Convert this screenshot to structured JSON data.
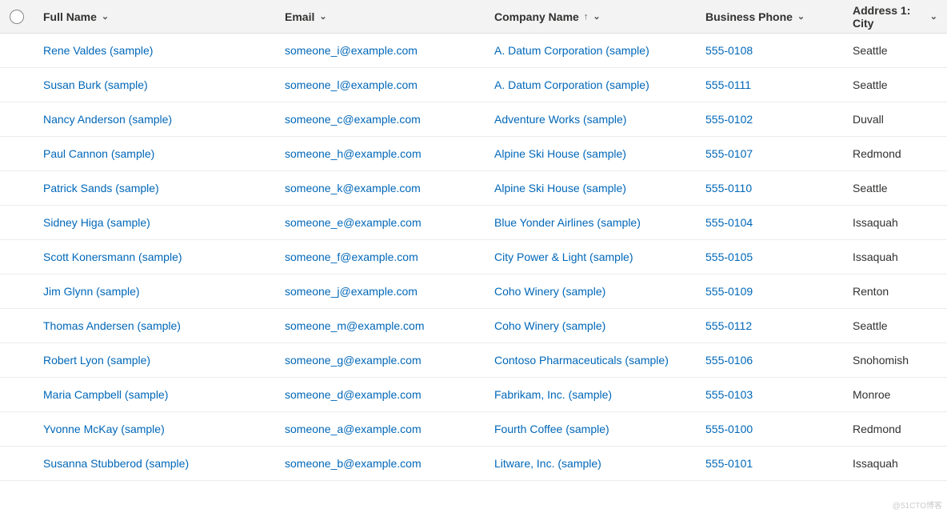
{
  "columns": {
    "fullname": "Full Name",
    "email": "Email",
    "company": "Company Name",
    "phone": "Business Phone",
    "city": "Address 1: City"
  },
  "sort": {
    "column": "company",
    "direction": "asc"
  },
  "rows": [
    {
      "fullname": "Rene Valdes (sample)",
      "email": "someone_i@example.com",
      "company": "A. Datum Corporation (sample)",
      "phone": "555-0108",
      "city": "Seattle"
    },
    {
      "fullname": "Susan Burk (sample)",
      "email": "someone_l@example.com",
      "company": "A. Datum Corporation (sample)",
      "phone": "555-0111",
      "city": "Seattle"
    },
    {
      "fullname": "Nancy Anderson (sample)",
      "email": "someone_c@example.com",
      "company": "Adventure Works (sample)",
      "phone": "555-0102",
      "city": "Duvall"
    },
    {
      "fullname": "Paul Cannon (sample)",
      "email": "someone_h@example.com",
      "company": "Alpine Ski House (sample)",
      "phone": "555-0107",
      "city": "Redmond"
    },
    {
      "fullname": "Patrick Sands (sample)",
      "email": "someone_k@example.com",
      "company": "Alpine Ski House (sample)",
      "phone": "555-0110",
      "city": "Seattle"
    },
    {
      "fullname": "Sidney Higa (sample)",
      "email": "someone_e@example.com",
      "company": "Blue Yonder Airlines (sample)",
      "phone": "555-0104",
      "city": "Issaquah"
    },
    {
      "fullname": "Scott Konersmann (sample)",
      "email": "someone_f@example.com",
      "company": "City Power & Light (sample)",
      "phone": "555-0105",
      "city": "Issaquah"
    },
    {
      "fullname": "Jim Glynn (sample)",
      "email": "someone_j@example.com",
      "company": "Coho Winery (sample)",
      "phone": "555-0109",
      "city": "Renton"
    },
    {
      "fullname": "Thomas Andersen (sample)",
      "email": "someone_m@example.com",
      "company": "Coho Winery (sample)",
      "phone": "555-0112",
      "city": "Seattle"
    },
    {
      "fullname": "Robert Lyon (sample)",
      "email": "someone_g@example.com",
      "company": "Contoso Pharmaceuticals (sample)",
      "phone": "555-0106",
      "city": "Snohomish"
    },
    {
      "fullname": "Maria Campbell (sample)",
      "email": "someone_d@example.com",
      "company": "Fabrikam, Inc. (sample)",
      "phone": "555-0103",
      "city": "Monroe"
    },
    {
      "fullname": "Yvonne McKay (sample)",
      "email": "someone_a@example.com",
      "company": "Fourth Coffee (sample)",
      "phone": "555-0100",
      "city": "Redmond"
    },
    {
      "fullname": "Susanna Stubberod (sample)",
      "email": "someone_b@example.com",
      "company": "Litware, Inc. (sample)",
      "phone": "555-0101",
      "city": "Issaquah"
    }
  ],
  "watermark": "@51CTO博客"
}
